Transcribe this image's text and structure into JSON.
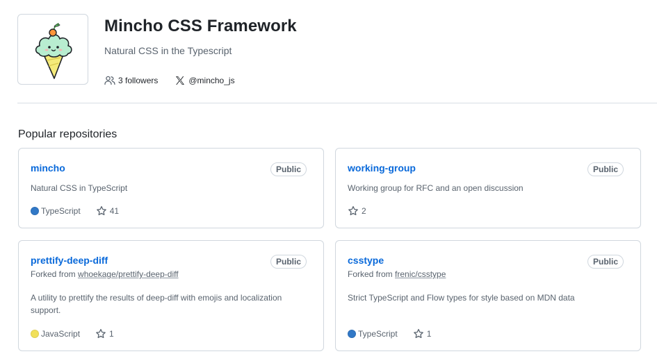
{
  "org": {
    "name": "Mincho CSS Framework",
    "description": "Natural CSS in the Typescript",
    "followers_label": "3 followers",
    "twitter_handle": "@mincho_js",
    "avatar_icon": "ice-cream-mascot"
  },
  "section": {
    "title": "Popular repositories"
  },
  "repos": [
    {
      "name": "mincho",
      "visibility": "Public",
      "description": "Natural CSS in TypeScript",
      "language": "TypeScript",
      "language_color": "#3178c6",
      "stars": "41"
    },
    {
      "name": "working-group",
      "visibility": "Public",
      "description": "Working group for RFC and an open discussion",
      "stars": "2"
    },
    {
      "name": "prettify-deep-diff",
      "visibility": "Public",
      "fork_prefix": "Forked from",
      "fork_source": "whoekage/prettify-deep-diff",
      "description": "A utility to prettify the results of deep-diff with emojis and localization support.",
      "language": "JavaScript",
      "language_color": "#f1e05a",
      "stars": "1"
    },
    {
      "name": "csstype",
      "visibility": "Public",
      "fork_prefix": "Forked from",
      "fork_source": "frenic/csstype",
      "description": "Strict TypeScript and Flow types for style based on MDN data",
      "language": "TypeScript",
      "language_color": "#3178c6",
      "stars": "1"
    }
  ],
  "icons": {
    "followers": "people-icon",
    "twitter": "x-logo-icon",
    "star": "star-icon"
  }
}
